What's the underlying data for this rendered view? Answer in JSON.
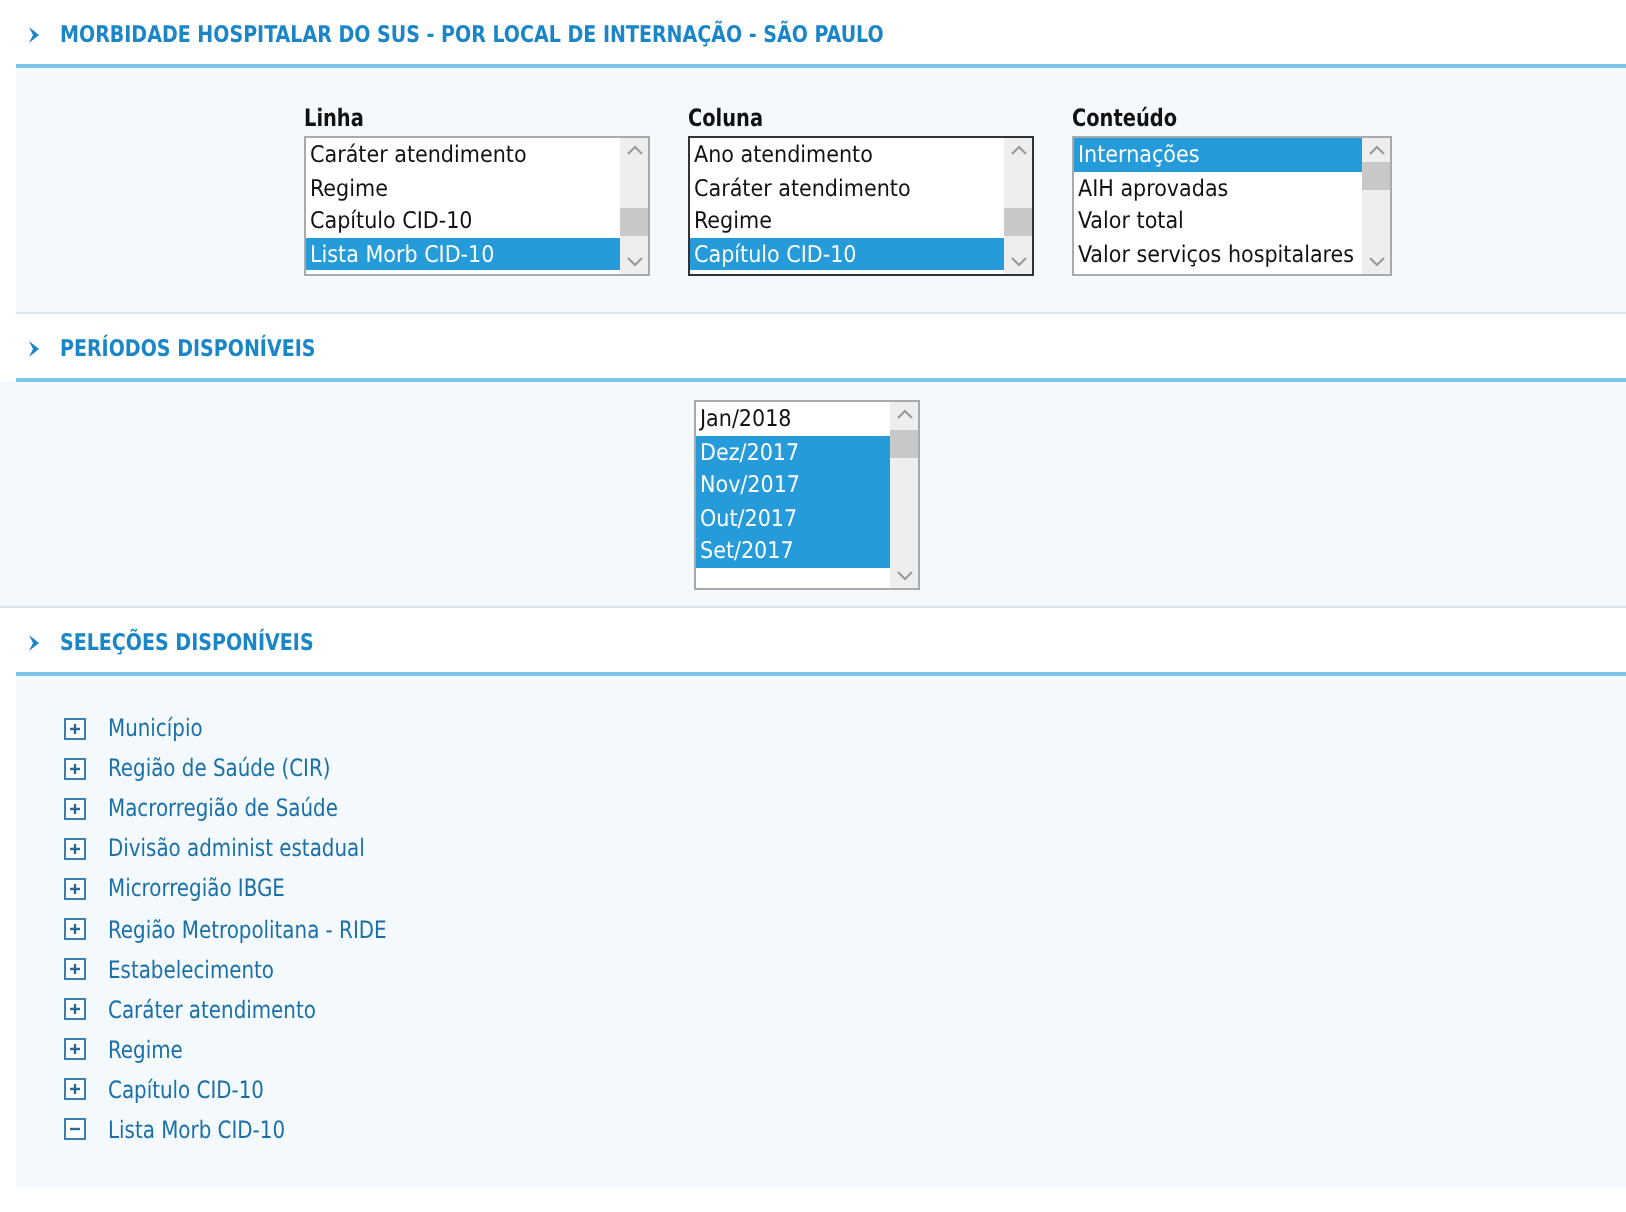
{
  "sections": [
    {
      "title": "MORBIDADE HOSPITALAR DO SUS - POR LOCAL DE INTERNAÇÃO - SÃO PAULO",
      "kind": "selectors",
      "listboxes": [
        {
          "label": "Linha",
          "focused": false,
          "items": [
            {
              "label": "Caráter atendimento",
              "selected": false
            },
            {
              "label": "Regime",
              "selected": false
            },
            {
              "label": "Capítulo CID-10",
              "selected": false
            },
            {
              "label": "Lista Morb CID-10",
              "selected": true
            }
          ]
        },
        {
          "label": "Coluna",
          "focused": true,
          "items": [
            {
              "label": "Ano atendimento",
              "selected": false
            },
            {
              "label": "Caráter atendimento",
              "selected": false
            },
            {
              "label": "Regime",
              "selected": false
            },
            {
              "label": "Capítulo CID-10",
              "selected": true
            }
          ]
        },
        {
          "label": "Conteúdo",
          "focused": false,
          "items": [
            {
              "label": "Internações",
              "selected": true
            },
            {
              "label": "AIH aprovadas",
              "selected": false
            },
            {
              "label": "Valor total",
              "selected": false
            },
            {
              "label": "Valor serviços hospitalares",
              "selected": false
            }
          ]
        }
      ]
    },
    {
      "title": "PERÍODOS DISPONÍVEIS",
      "kind": "periods",
      "listboxes": [
        {
          "focused": false,
          "items": [
            {
              "label": "Jan/2018",
              "selected": false
            },
            {
              "label": "Dez/2017",
              "selected": true
            },
            {
              "label": "Nov/2017",
              "selected": true
            },
            {
              "label": "Out/2017",
              "selected": true
            },
            {
              "label": "Set/2017",
              "selected": true
            }
          ]
        }
      ]
    },
    {
      "title": "SELEÇÕES DISPONÍVEIS",
      "kind": "tree",
      "items": [
        {
          "label": "Município",
          "expanded": false
        },
        {
          "label": "Região de Saúde (CIR)",
          "expanded": false
        },
        {
          "label": "Macrorregião de Saúde",
          "expanded": false
        },
        {
          "label": "Divisão administ estadual",
          "expanded": false
        },
        {
          "label": "Microrregião IBGE",
          "expanded": false
        },
        {
          "label": "Região Metropolitana - RIDE",
          "expanded": false
        },
        {
          "label": "Estabelecimento",
          "expanded": false
        },
        {
          "label": "Caráter atendimento",
          "expanded": false
        },
        {
          "label": "Regime",
          "expanded": false
        },
        {
          "label": "Capítulo CID-10",
          "expanded": false
        },
        {
          "label": "Lista Morb CID-10",
          "expanded": true
        }
      ]
    }
  ]
}
